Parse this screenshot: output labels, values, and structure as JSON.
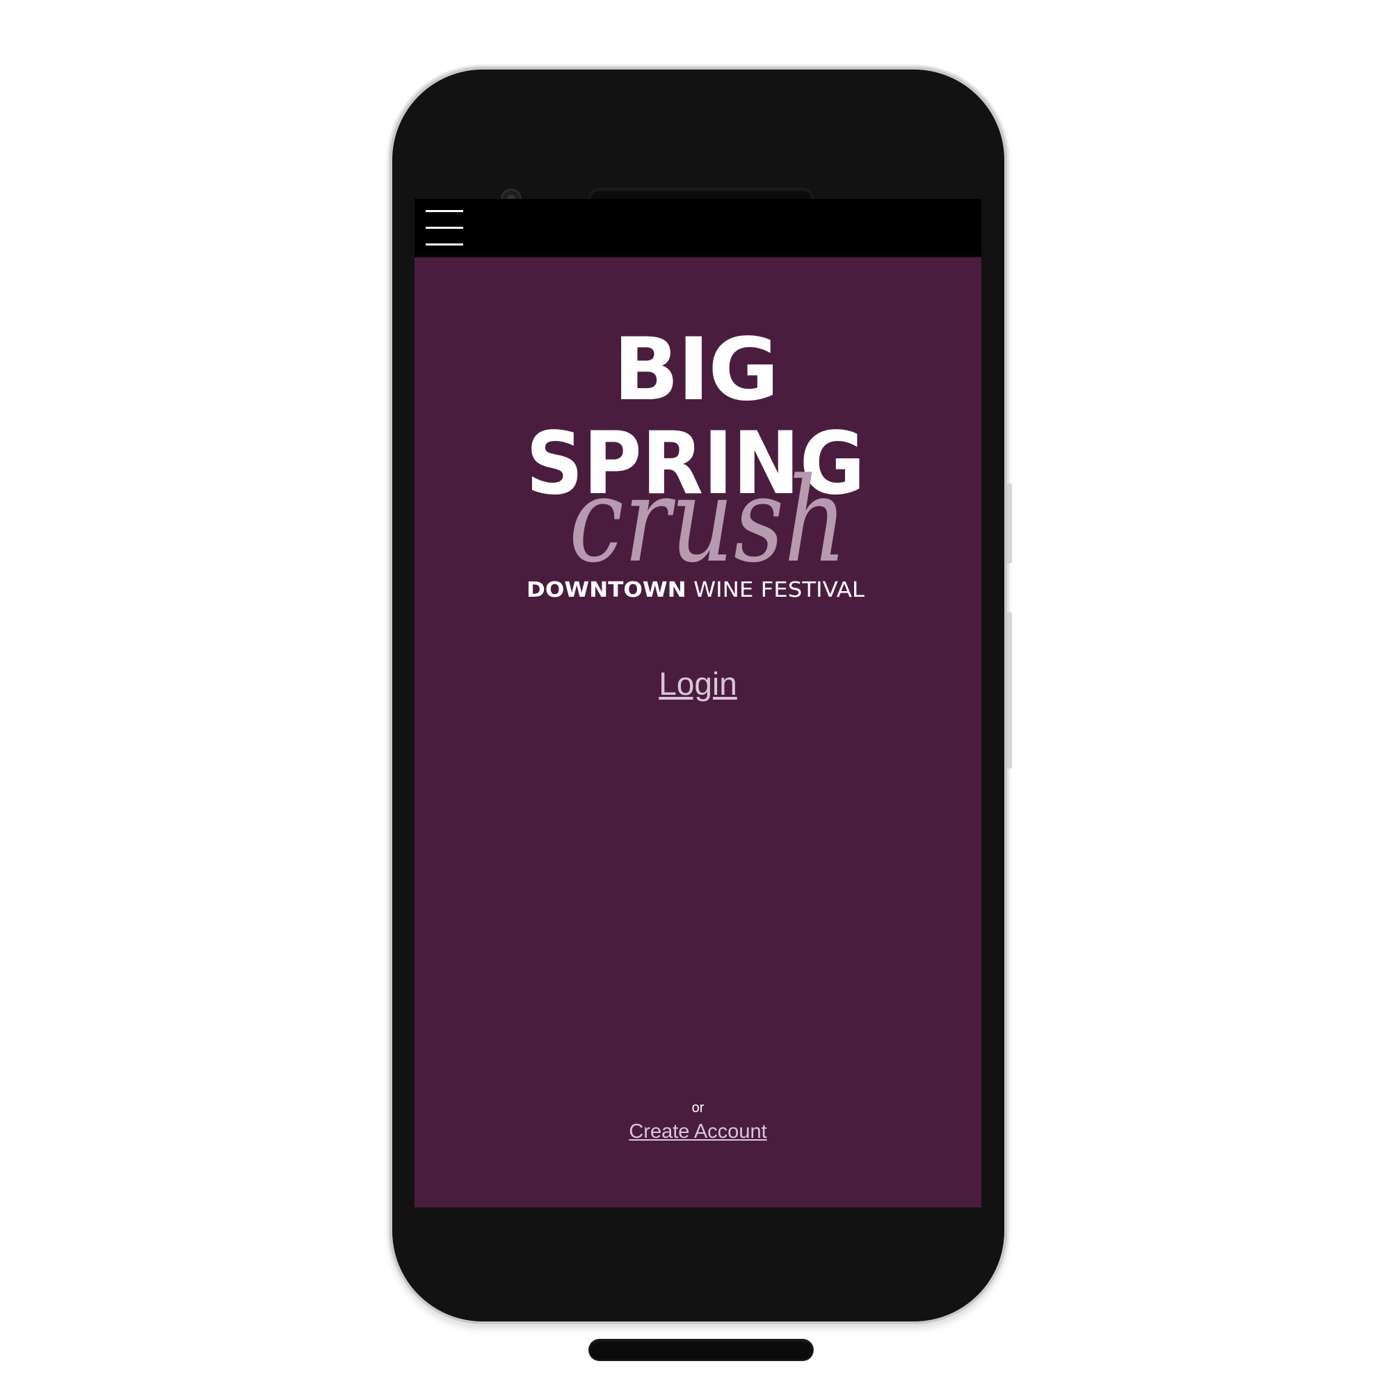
{
  "app": {
    "logo": {
      "line1": "BIG",
      "line2": "SPRING",
      "script": "crush",
      "tagline_bold": "DOWNTOWN",
      "tagline_light": "WINE FESTIVAL"
    },
    "login_label": "Login",
    "or_label": "or",
    "create_account_label": "Create Account"
  },
  "icons": {
    "menu": "hamburger-menu-icon"
  },
  "colors": {
    "background": "#4a1d3f",
    "top_bar": "#000000",
    "link": "#d9c6d5",
    "script_accent": "#b79aaf"
  }
}
